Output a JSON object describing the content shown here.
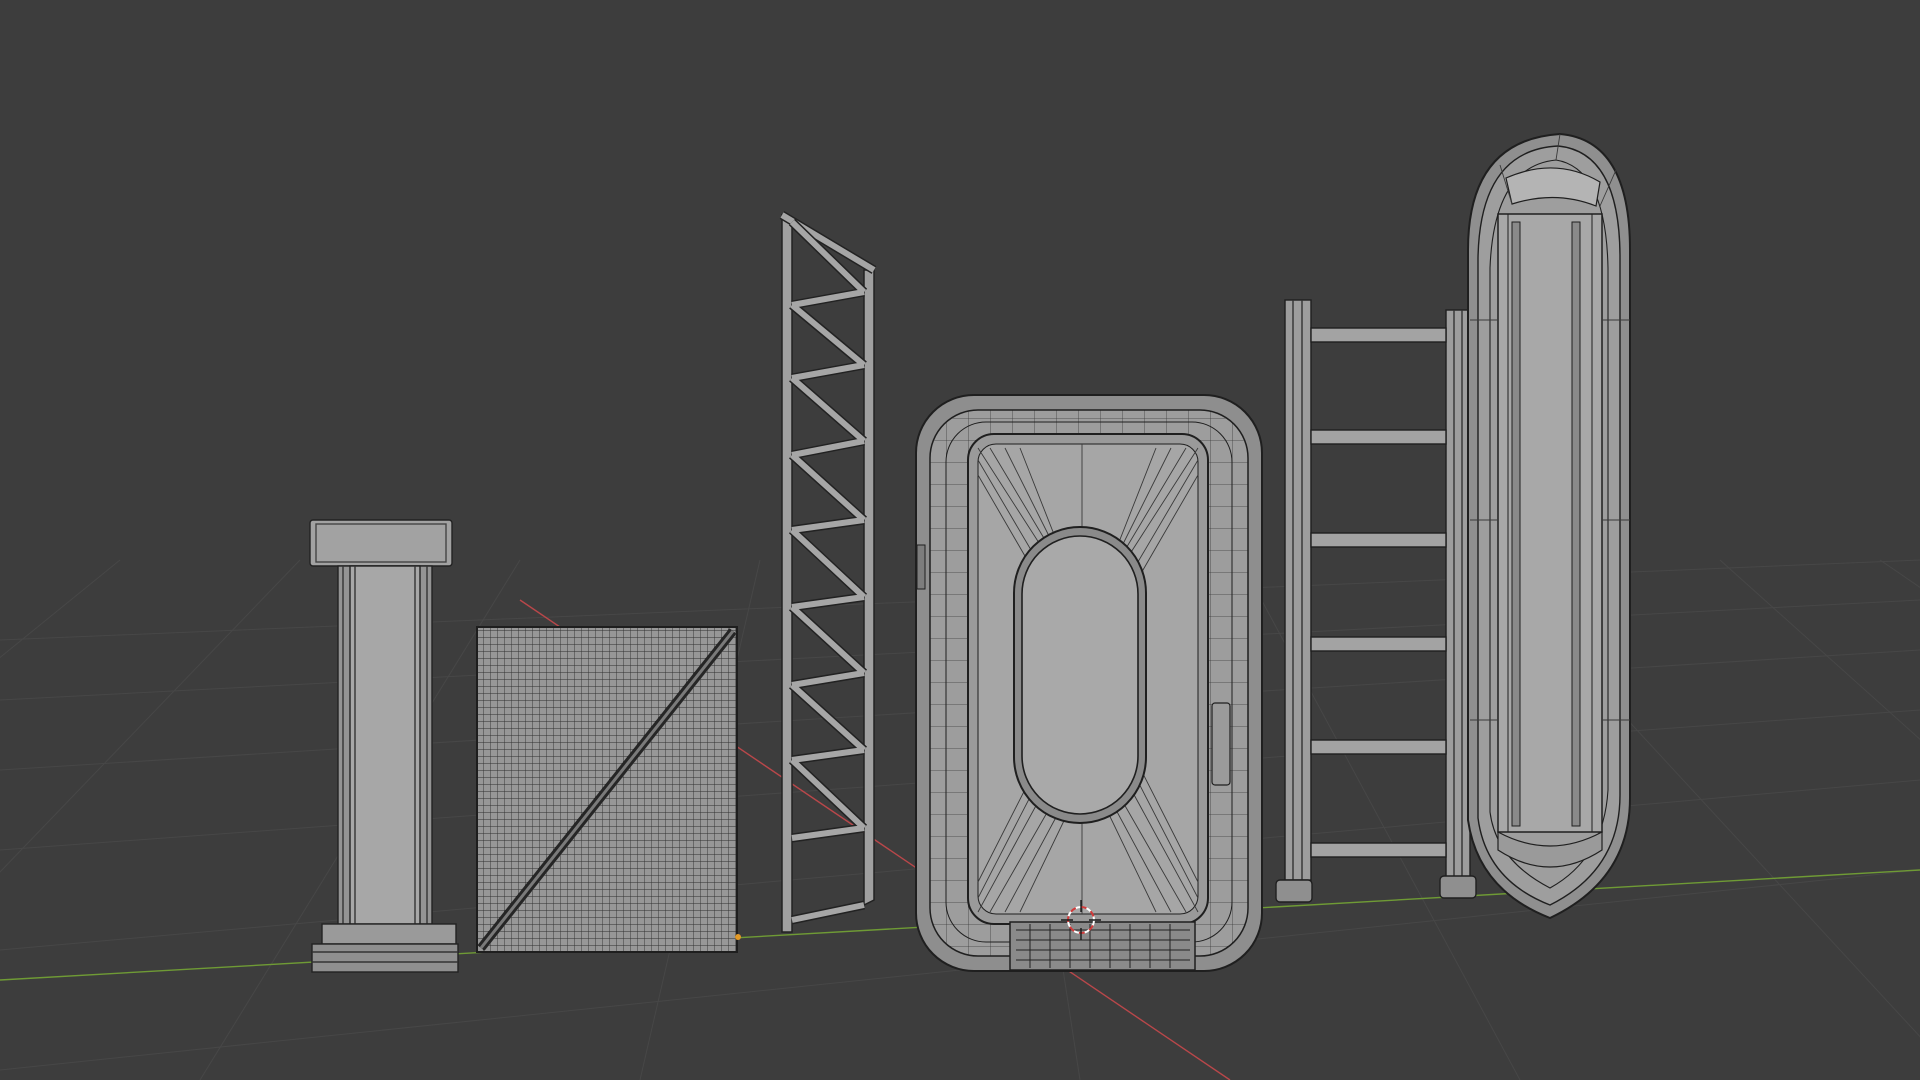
{
  "viewport": {
    "name": "3D Viewport",
    "shading": "solid-wireframe",
    "background_color": "#3d3d3d",
    "grid_color": "#4a4a4a",
    "x_axis_color": "#b9474a",
    "y_axis_color": "#6f9b35",
    "object_color": "#9a9a9a",
    "wire_color": "#2a2a2a"
  },
  "objects": [
    {
      "name": "pillar"
    },
    {
      "name": "rough-panel"
    },
    {
      "name": "truss-frame"
    },
    {
      "name": "hatch-door"
    },
    {
      "name": "ladder"
    },
    {
      "name": "capsule-door"
    }
  ],
  "icons": {
    "cursor": "3d-cursor-icon",
    "origin": "origin-point-icon"
  }
}
